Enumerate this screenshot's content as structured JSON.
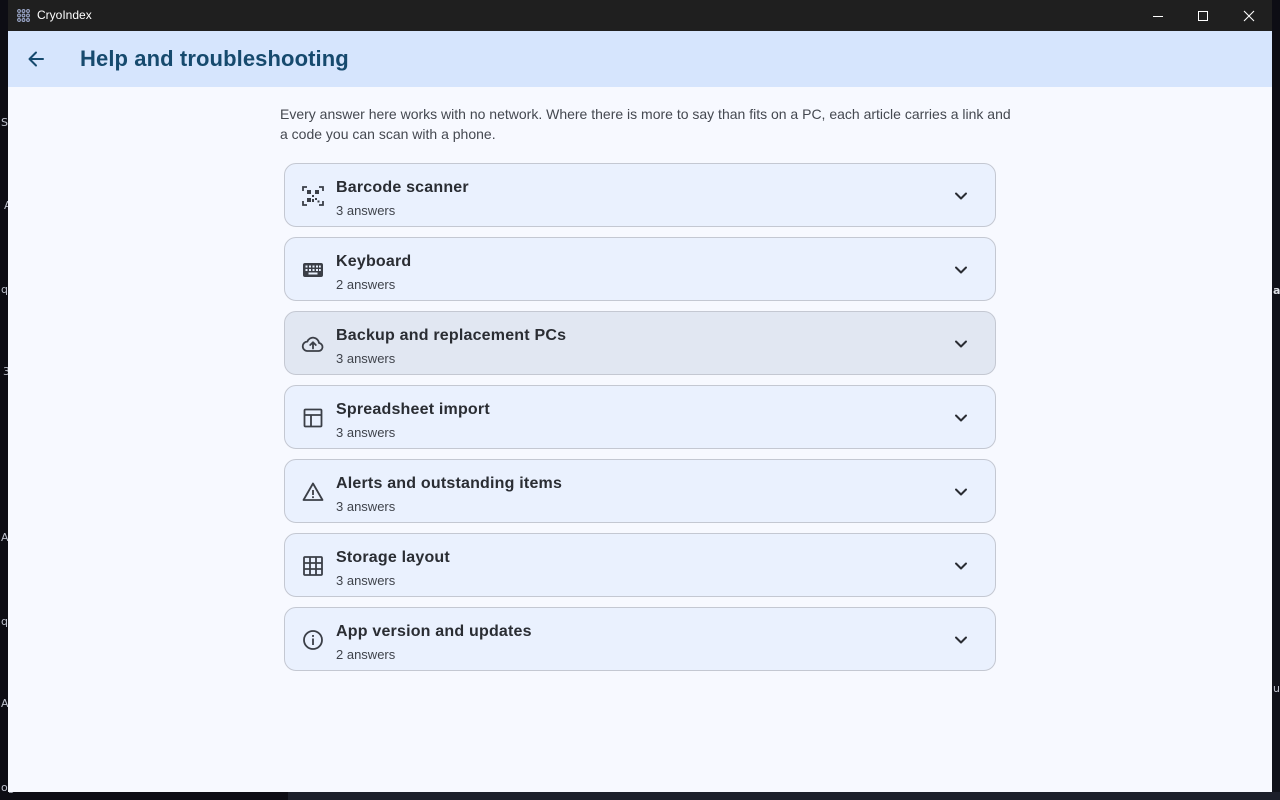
{
  "window": {
    "app_title": "CryoIndex",
    "controls": {
      "minimize": "minimize-icon",
      "maximize": "maximize-icon",
      "close": "close-icon"
    }
  },
  "header": {
    "back_icon": "arrow-left-icon",
    "title": "Help and troubleshooting"
  },
  "intro": "Every answer here works with no network. Where there is more to say than fits on a PC, each article carries a link and a code you can scan with a phone.",
  "topics": [
    {
      "title": "Barcode scanner",
      "count": "3 answers",
      "icon": "qr-scanner-icon"
    },
    {
      "title": "Keyboard",
      "count": "2 answers",
      "icon": "keyboard-icon"
    },
    {
      "title": "Backup and replacement PCs",
      "count": "3 answers",
      "icon": "cloud-upload-icon"
    },
    {
      "title": "Spreadsheet import",
      "count": "3 answers",
      "icon": "table-icon"
    },
    {
      "title": "Alerts and outstanding items",
      "count": "3 answers",
      "icon": "warning-icon"
    },
    {
      "title": "Storage layout",
      "count": "3 answers",
      "icon": "grid-icon"
    },
    {
      "title": "App version and updates",
      "count": "2 answers",
      "icon": "info-icon"
    }
  ],
  "background": {
    "fragments": [
      "S",
      "A",
      "q",
      "3",
      "A",
      "q",
      "A",
      "og",
      "a",
      "ur"
    ]
  },
  "colors": {
    "appbar": "#d6e5fd",
    "title": "#164a6e",
    "card": "#eaf1fe",
    "card_hover": "#e1e7f2"
  }
}
